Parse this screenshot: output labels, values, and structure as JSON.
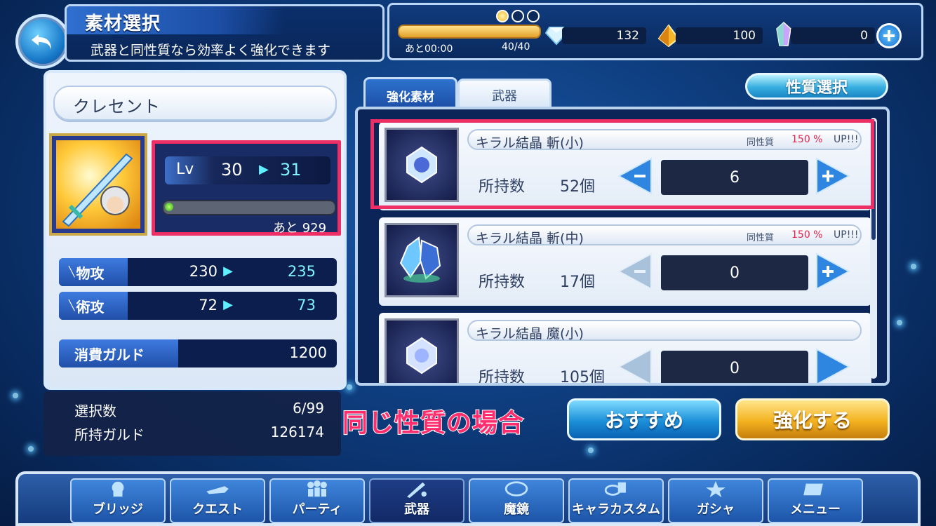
{
  "header": {
    "title": "素材選択",
    "subtitle": "武器と同性質なら効率よく強化できます"
  },
  "status": {
    "stamina_timer": "あと00:00",
    "stamina_count": "40/40",
    "stamina_level": 1.0,
    "gems": "132",
    "crystals": "100",
    "special": "0"
  },
  "character": {
    "name": "クレセント",
    "lv_label": "Lv",
    "lv_from": "30",
    "lv_to": "31",
    "exp_remain": "あと 929",
    "exp_level": 0.02,
    "stats": [
      {
        "label": "物攻",
        "from": "230",
        "to": "235"
      },
      {
        "label": "術攻",
        "from": "72",
        "to": "73"
      }
    ],
    "cost_label": "消費ガルド",
    "cost_value": "1200"
  },
  "summary": {
    "selected_label": "選択数",
    "selected_value": "6/99",
    "gold_label": "所持ガルド",
    "gold_value": "126174"
  },
  "tabs": {
    "strengthen": "強化素材",
    "weapon": "武器"
  },
  "nature_button": "性質選択",
  "items": [
    {
      "name": "キラル結晶 斬(小)",
      "bonus_label": "同性質",
      "bonus": "150 %",
      "bonus_up": "UP!!!",
      "owned_label": "所持数",
      "owned": "52個",
      "qty": "6"
    },
    {
      "name": "キラル結晶 斬(中)",
      "bonus_label": "同性質",
      "bonus": "150 %",
      "bonus_up": "UP!!!",
      "owned_label": "所持数",
      "owned": "17個",
      "qty": "0"
    },
    {
      "name": "キラル結晶 魔(小)",
      "bonus_label": "",
      "bonus": "",
      "bonus_up": "",
      "owned_label": "所持数",
      "owned": "105個",
      "qty": "0"
    }
  ],
  "annotation": "同じ性質の場合",
  "buttons": {
    "recommend": "おすすめ",
    "enhance": "強化する"
  },
  "nav": [
    "ブリッジ",
    "クエスト",
    "パーティ",
    "武器",
    "魔鏡",
    "キャラカスタム",
    "ガシャ",
    "メニュー"
  ],
  "colors": {
    "highlight": "#ee2f66",
    "bonus": "#e8234b"
  }
}
